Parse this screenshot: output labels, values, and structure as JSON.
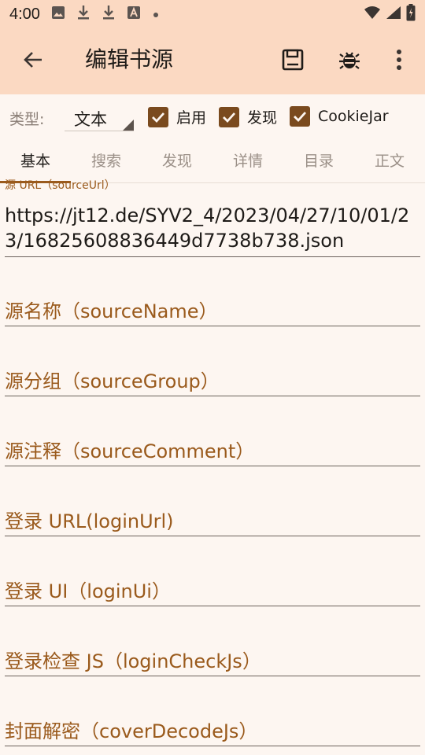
{
  "status_bar": {
    "time": "4:00",
    "left_icons": [
      "image-icon",
      "download-icon",
      "download-icon",
      "font-icon",
      "dot-icon"
    ],
    "right_icons": [
      "wifi-icon",
      "signal-icon",
      "battery-icon"
    ]
  },
  "app_bar": {
    "title": "编辑书源",
    "actions": [
      "save-icon",
      "bug-icon",
      "more-vert-icon"
    ]
  },
  "type_row": {
    "type_label": "类型:",
    "type_value": "文本",
    "checkboxes": [
      {
        "label": "启用",
        "checked": true
      },
      {
        "label": "发现",
        "checked": true
      },
      {
        "label": "CookieJar",
        "checked": true
      }
    ]
  },
  "tabs": [
    {
      "label": "基本",
      "active": true
    },
    {
      "label": "搜索",
      "active": false
    },
    {
      "label": "发现",
      "active": false
    },
    {
      "label": "详情",
      "active": false
    },
    {
      "label": "目录",
      "active": false
    },
    {
      "label": "正文",
      "active": false
    }
  ],
  "fields": {
    "source_url": {
      "label": "源 URL（sourceUrl）",
      "value": "https://jt12.de/SYV2_4/2023/04/27/10/01/23/16825608836449d7738b738.json"
    },
    "hints": [
      "源名称（sourceName）",
      "源分组（sourceGroup）",
      "源注释（sourceComment）",
      "登录 URL(loginUrl)",
      "登录 UI（loginUi）",
      "登录检查 JS（loginCheckJs）",
      "封面解密（coverDecodeJs）"
    ]
  },
  "colors": {
    "app_bar_bg": "#fbd9c2",
    "accent": "#9a5a1c",
    "checkbox": "#7a4a1e",
    "background": "#fdf6f1"
  }
}
